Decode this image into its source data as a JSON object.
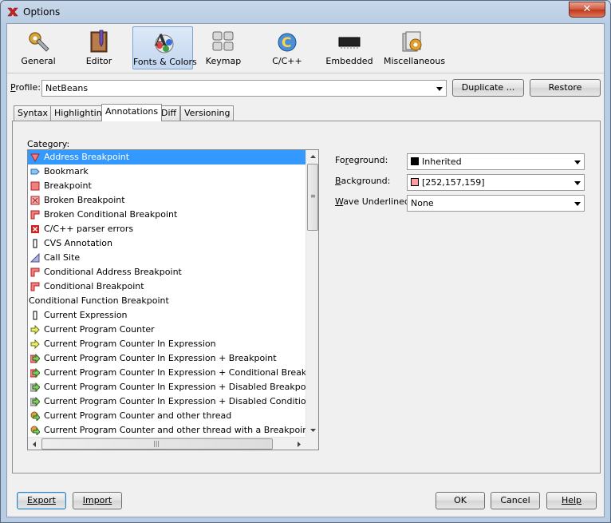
{
  "window": {
    "title": "Options",
    "close_glyph": "✕"
  },
  "categories": [
    {
      "label": "General",
      "icon": "gear-wrench-icon"
    },
    {
      "label": "Editor",
      "icon": "pencil-book-icon"
    },
    {
      "label": "Fonts & Colors",
      "icon": "fonts-colors-icon",
      "selected": true
    },
    {
      "label": "Keymap",
      "icon": "keyboard-icon"
    },
    {
      "label": "C/C++",
      "icon": "cpp-icon"
    },
    {
      "label": "Embedded",
      "icon": "chip-icon"
    },
    {
      "label": "Miscellaneous",
      "icon": "misc-gear-icon"
    }
  ],
  "profile": {
    "label": "Profile:",
    "value": "NetBeans",
    "duplicate_label": "Duplicate ...",
    "restore_label": "Restore"
  },
  "tabs": [
    "Syntax",
    "Highlighting",
    "Annotations",
    "Diff",
    "Versioning"
  ],
  "active_tab": "Annotations",
  "category_label": "Category:",
  "annotations": [
    {
      "label": "Address Breakpoint",
      "icon": "address-breakpoint-icon",
      "selected": true
    },
    {
      "label": "Bookmark",
      "icon": "bookmark-icon"
    },
    {
      "label": "Breakpoint",
      "icon": "breakpoint-icon"
    },
    {
      "label": "Broken Breakpoint",
      "icon": "broken-breakpoint-icon"
    },
    {
      "label": "Broken Conditional Breakpoint",
      "icon": "broken-conditional-breakpoint-icon"
    },
    {
      "label": "C/C++ parser errors",
      "icon": "parser-error-icon"
    },
    {
      "label": "CVS Annotation",
      "icon": "cvs-annotation-icon"
    },
    {
      "label": "Call Site",
      "icon": "call-site-icon"
    },
    {
      "label": "Conditional Address Breakpoint",
      "icon": "conditional-address-breakpoint-icon"
    },
    {
      "label": "Conditional Breakpoint",
      "icon": "conditional-breakpoint-icon"
    },
    {
      "label": "Conditional Function Breakpoint",
      "icon": ""
    },
    {
      "label": "Current Expression",
      "icon": "current-expression-icon"
    },
    {
      "label": "Current Program Counter",
      "icon": "program-counter-icon"
    },
    {
      "label": "Current Program Counter In Expression",
      "icon": "program-counter-icon"
    },
    {
      "label": "Current Program Counter In Expression + Breakpoint",
      "icon": "program-counter-breakpoint-icon"
    },
    {
      "label": "Current Program Counter In Expression + Conditional Breakpoint",
      "icon": "program-counter-breakpoint-icon"
    },
    {
      "label": "Current Program Counter In Expression + Disabled Breakpoint",
      "icon": "program-counter-disabled-icon"
    },
    {
      "label": "Current Program Counter In Expression + Disabled Conditional Breakpoint",
      "icon": "program-counter-disabled-icon"
    },
    {
      "label": "Current Program Counter and other thread",
      "icon": "program-counter-thread-icon"
    },
    {
      "label": "Current Program Counter and other thread with a Breakpoint",
      "icon": "program-counter-thread-icon"
    }
  ],
  "properties": {
    "foreground": {
      "label": "Foreground:",
      "value": "Inherited",
      "swatch": "#000000"
    },
    "background": {
      "label": "Background:",
      "value": "[252,157,159]",
      "swatch": "#fc9d9f"
    },
    "wave": {
      "label": "Wave Underlined:",
      "value": "None"
    }
  },
  "footer": {
    "export_label": "Export",
    "import_label": "Import",
    "ok_label": "OK",
    "cancel_label": "Cancel",
    "help_label": "Help"
  }
}
